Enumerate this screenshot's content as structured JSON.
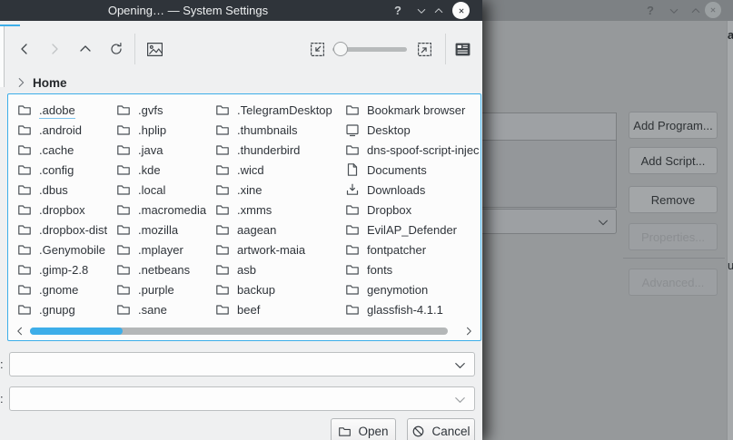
{
  "colors": {
    "accent": "#3daee9",
    "titlebar_bg": "#2f343a",
    "titlebar_text": "#eef0f1",
    "dialog_bg": "#eff0f1",
    "list_bg": "#fcfcfc",
    "scroll_thumb": "#3daee9",
    "dim_window_bg": "#96999b"
  },
  "window": {
    "title": "Opening… — System Settings",
    "titlebar": {
      "help_label": "?"
    }
  },
  "toolbar": {
    "icons": [
      "go-back",
      "go-forward",
      "go-up",
      "refresh",
      "image-preview",
      "zoom-out",
      "zoom-slider",
      "zoom-in",
      "details-view"
    ]
  },
  "breadcrumb": {
    "location": "Home"
  },
  "file_columns": [
    [
      {
        "label": ".adobe",
        "icon": "folder",
        "selected": true
      },
      {
        "label": ".android",
        "icon": "folder"
      },
      {
        "label": ".cache",
        "icon": "folder"
      },
      {
        "label": ".config",
        "icon": "folder"
      },
      {
        "label": ".dbus",
        "icon": "folder"
      },
      {
        "label": ".dropbox",
        "icon": "folder"
      },
      {
        "label": ".dropbox-dist",
        "icon": "folder"
      },
      {
        "label": ".Genymobile",
        "icon": "folder"
      },
      {
        "label": ".gimp-2.8",
        "icon": "folder"
      },
      {
        "label": ".gnome",
        "icon": "folder"
      },
      {
        "label": ".gnupg",
        "icon": "folder"
      }
    ],
    [
      {
        "label": ".gvfs",
        "icon": "folder"
      },
      {
        "label": ".hplip",
        "icon": "folder"
      },
      {
        "label": ".java",
        "icon": "folder"
      },
      {
        "label": ".kde",
        "icon": "folder"
      },
      {
        "label": ".local",
        "icon": "folder"
      },
      {
        "label": ".macromedia",
        "icon": "folder"
      },
      {
        "label": ".mozilla",
        "icon": "folder"
      },
      {
        "label": ".mplayer",
        "icon": "folder"
      },
      {
        "label": ".netbeans",
        "icon": "folder"
      },
      {
        "label": ".purple",
        "icon": "folder"
      },
      {
        "label": ".sane",
        "icon": "folder"
      }
    ],
    [
      {
        "label": ".TelegramDesktop",
        "icon": "folder"
      },
      {
        "label": ".thumbnails",
        "icon": "folder"
      },
      {
        "label": ".thunderbird",
        "icon": "folder"
      },
      {
        "label": ".wicd",
        "icon": "folder"
      },
      {
        "label": ".xine",
        "icon": "folder"
      },
      {
        "label": ".xmms",
        "icon": "folder"
      },
      {
        "label": "aagean",
        "icon": "folder"
      },
      {
        "label": "artwork-maia",
        "icon": "folder"
      },
      {
        "label": "asb",
        "icon": "folder"
      },
      {
        "label": "backup",
        "icon": "folder"
      },
      {
        "label": "beef",
        "icon": "folder"
      }
    ],
    [
      {
        "label": "Bookmark browser",
        "icon": "folder"
      },
      {
        "label": "Desktop",
        "icon": "desktop"
      },
      {
        "label": "dns-spoof-script-inject",
        "icon": "folder"
      },
      {
        "label": "Documents",
        "icon": "document"
      },
      {
        "label": "Downloads",
        "icon": "download"
      },
      {
        "label": "Dropbox",
        "icon": "folder"
      },
      {
        "label": "EvilAP_Defender",
        "icon": "folder"
      },
      {
        "label": "fontpatcher",
        "icon": "folder"
      },
      {
        "label": "fonts",
        "icon": "folder"
      },
      {
        "label": "genymotion",
        "icon": "folder"
      },
      {
        "label": "glassfish-4.1.1",
        "icon": "folder"
      }
    ]
  ],
  "name_row": {
    "label_fragment": ":"
  },
  "filter_row": {
    "label_fragment": ":"
  },
  "buttons": {
    "open": "Open",
    "cancel": "Cancel"
  },
  "background_window": {
    "titlebar": {
      "help_label": "?"
    },
    "buttons": [
      {
        "label": "Add Program...",
        "enabled": true
      },
      {
        "label": "Add Script...",
        "enabled": true
      },
      {
        "label": "Remove",
        "enabled": true
      },
      {
        "label": "Properties...",
        "enabled": false
      },
      {
        "label": "Advanced...",
        "enabled": false
      }
    ],
    "edge_fragments": {
      "top": "a",
      "middle": "u"
    }
  }
}
